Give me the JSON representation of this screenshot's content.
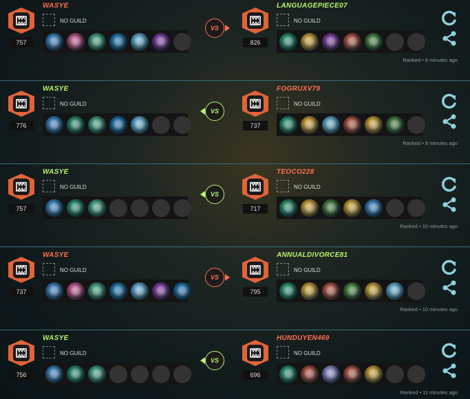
{
  "colors": {
    "loss": "#ff6f52",
    "win": "#b9f36f",
    "accent_icon": "#8fd0dd",
    "hero_palette": [
      "#2f7fc2",
      "#cc4d8c",
      "#3aa07d",
      "#0f6fae",
      "#5fb3d9",
      "#7e2fa0",
      "#1d8f6a",
      "#d7a329",
      "#b64834",
      "#3b7c2f",
      "#8a8bcf",
      "#c9c24f"
    ]
  },
  "labels": {
    "no_guild": "NO GUILD",
    "vs": "VS"
  },
  "matches": [
    {
      "result_left": "loss",
      "left": {
        "name": "WASYE",
        "rating": "757",
        "heroes": [
          0,
          1,
          2,
          3,
          4,
          5,
          -1
        ]
      },
      "right": {
        "name": "LANGUAGEPIECE07",
        "rating": "826",
        "heroes": [
          6,
          7,
          5,
          8,
          9,
          -1,
          -1
        ]
      },
      "meta": "Ranked • 8 minutes ago"
    },
    {
      "result_left": "win",
      "left": {
        "name": "WASYE",
        "rating": "776",
        "heroes": [
          0,
          6,
          2,
          3,
          4,
          -1,
          -1
        ]
      },
      "right": {
        "name": "FOGRUXV79",
        "rating": "737",
        "heroes": [
          6,
          7,
          4,
          8,
          7,
          9,
          -1
        ]
      },
      "meta": "Ranked • 9 minutes ago"
    },
    {
      "result_left": "win",
      "left": {
        "name": "WASYE",
        "rating": "757",
        "heroes": [
          0,
          6,
          2,
          -1,
          -1,
          -1,
          -1
        ]
      },
      "right": {
        "name": "TEOCO228",
        "rating": "717",
        "heroes": [
          6,
          7,
          9,
          7,
          0,
          -1,
          -1
        ]
      },
      "meta": "Ranked • 10 minutes ago"
    },
    {
      "result_left": "loss",
      "left": {
        "name": "WASYE",
        "rating": "737",
        "heroes": [
          0,
          1,
          2,
          3,
          4,
          5,
          3
        ]
      },
      "right": {
        "name": "ANNUALDIVORCE81",
        "rating": "795",
        "heroes": [
          6,
          7,
          8,
          9,
          7,
          4,
          -1
        ]
      },
      "meta": "Ranked • 10 minutes ago"
    },
    {
      "result_left": "win",
      "left": {
        "name": "WASYE",
        "rating": "756",
        "heroes": [
          0,
          6,
          2,
          -1,
          -1,
          -1,
          -1
        ]
      },
      "right": {
        "name": "HUNDUYEN469",
        "rating": "696",
        "heroes": [
          6,
          8,
          10,
          8,
          7,
          -1,
          -1
        ]
      },
      "meta": "Ranked • 11 minutes ago"
    }
  ],
  "icons": {
    "badge": "fang-crest-icon",
    "refresh": "refresh-icon",
    "share": "share-icon"
  }
}
